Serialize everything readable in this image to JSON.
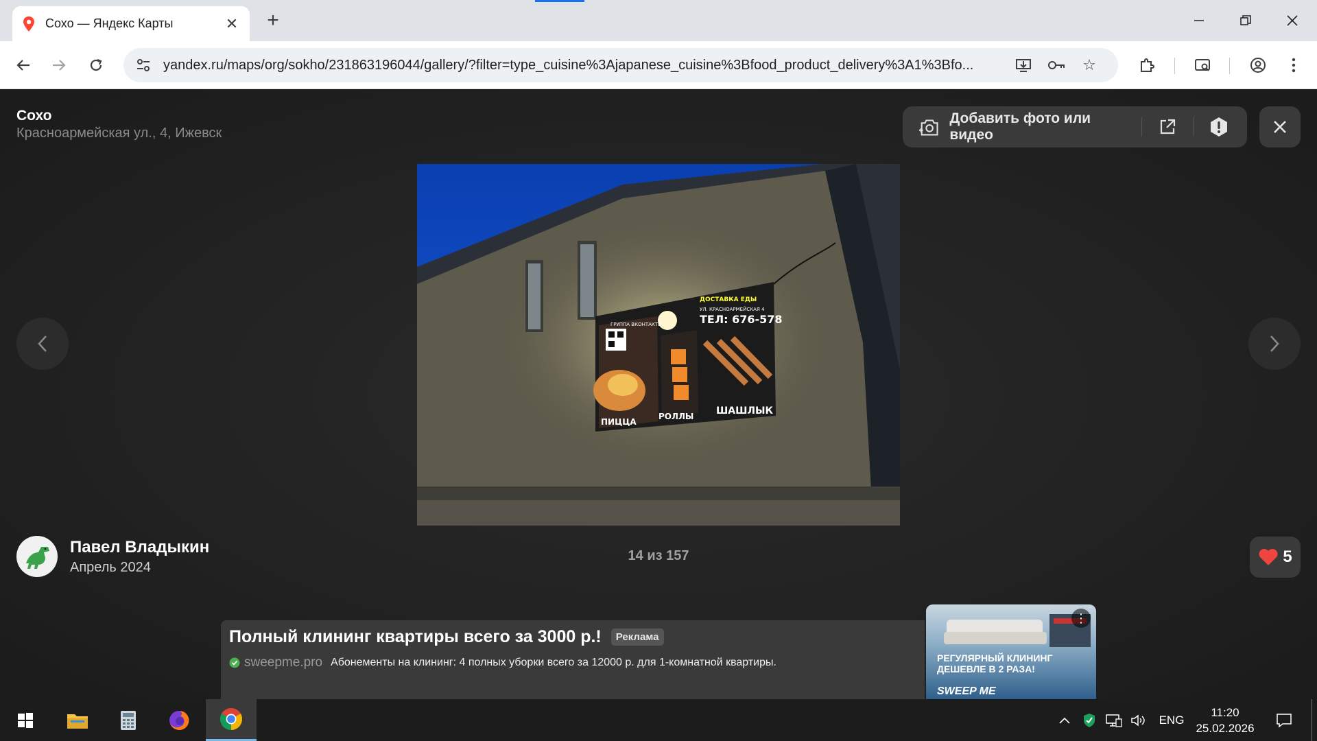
{
  "browser": {
    "tab_title": "Сохо — Яндекс Карты",
    "url": "yandex.ru/maps/org/sokho/231863196044/gallery/?filter=type_cuisine%3Ajapanese_cuisine%3Bfood_product_delivery%3A1%3Bfo...",
    "accent_color": "#1a73e8"
  },
  "viewer": {
    "place_name": "Сохо",
    "place_address": "Красноармейская ул., 4, Ижевск",
    "add_media_label": "Добавить фото или видео",
    "author_name": "Павел Владыкин",
    "author_date": "Апрель 2024",
    "counter": "14 из 157",
    "likes": "5",
    "like_color": "#f0443e",
    "photo_sign": {
      "top_left": "ГРУППА ВКОНТАКТЕ",
      "delivery": "ДОСТАВКА ЕДЫ",
      "street": "УЛ. КРАСНОАРМЕЙСКАЯ 4",
      "phone": "ТЕЛ: 676-578",
      "items": [
        "ПИЦЦА",
        "РОЛЛЫ",
        "ШАШЛЫК"
      ]
    }
  },
  "ad": {
    "headline": "Полный клининг квартиры всего за 3000 р.!",
    "badge": "Реклама",
    "domain": "sweepme.pro",
    "description": "Абонементы на клининг: 4 полных уборки всего за 12000 р. для 1-комнатной квартиры.",
    "image_text": "РЕГУЛЯРНЫЙ КЛИНИНГ ДЕШЕВЛЕ В 2 РАЗА!",
    "image_brand": "SWEEP ME"
  },
  "taskbar": {
    "language": "ENG",
    "time": "11:20",
    "date": "25.02.2026"
  }
}
